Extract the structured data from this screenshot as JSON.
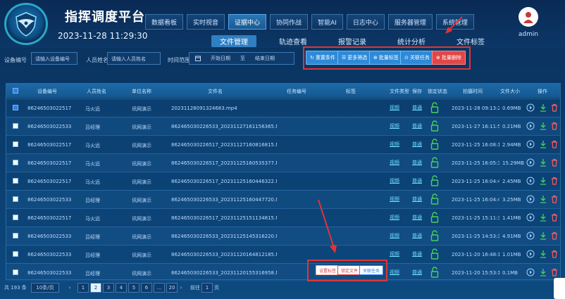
{
  "header": {
    "title": "指挥调度平台",
    "datetime": "2023-11-28 11:29:30",
    "username": "admin",
    "nav_tabs": [
      {
        "label": "数据看板",
        "active": false
      },
      {
        "label": "实时视音",
        "active": false
      },
      {
        "label": "证据中心",
        "active": true
      },
      {
        "label": "协同作战",
        "active": false
      },
      {
        "label": "智能AI",
        "active": false
      },
      {
        "label": "日志中心",
        "active": false
      },
      {
        "label": "服务器管理",
        "active": false
      },
      {
        "label": "系统管理",
        "active": false
      }
    ],
    "sub_tabs": [
      {
        "label": "文件管理",
        "active": true
      },
      {
        "label": "轨迹查看",
        "active": false
      },
      {
        "label": "报警记录",
        "active": false
      },
      {
        "label": "统计分析",
        "active": false
      },
      {
        "label": "文件标签",
        "active": false
      }
    ]
  },
  "filters": {
    "device_label": "设备编号",
    "device_placeholder": "请输入设备编号",
    "person_label": "人员姓名",
    "person_placeholder": "请输入人员姓名",
    "time_label": "时间范围",
    "start_placeholder": "开始日期",
    "range_sep": "至",
    "end_placeholder": "结束日期"
  },
  "actions": [
    {
      "label": "重置条件",
      "style": "blue"
    },
    {
      "label": "更多筛选",
      "style": "blue"
    },
    {
      "label": "批量标签",
      "style": "blue"
    },
    {
      "label": "关联任务",
      "style": "blue"
    },
    {
      "label": "批量删除",
      "style": "red"
    }
  ],
  "table": {
    "columns": [
      "设备编号",
      "人员姓名",
      "单位名称",
      "文件名",
      "任务编号",
      "标签",
      "文件类型",
      "保存",
      "锁定状态",
      "拍摄时间",
      "文件大小",
      "操作"
    ],
    "rows": [
      {
        "checked": true,
        "device": "86246503022517",
        "person": "马火远",
        "unit": "讯网演示",
        "file": "20231128091324683.mp4",
        "task": "",
        "tag": "",
        "type": "视频",
        "save": "普通",
        "time": "2023-11-28 09:13:28",
        "size": "0.69MB"
      },
      {
        "checked": false,
        "device": "86246503022533",
        "person": "吕经理",
        "unit": "讯网演示",
        "file": "862465030226533_20231127161156365.MP4",
        "task": "",
        "tag": "",
        "type": "视频",
        "save": "普通",
        "time": "2023-11-27 16:11:56",
        "size": "0.21MB"
      },
      {
        "checked": false,
        "device": "86246503022517",
        "person": "马火远",
        "unit": "讯网演示",
        "file": "862465030226517_20231127160816815.MP4",
        "task": "",
        "tag": "",
        "type": "视频",
        "save": "普通",
        "time": "2023-11-25 16:08:18",
        "size": "2.94MB"
      },
      {
        "checked": false,
        "device": "86246503022517",
        "person": "马火远",
        "unit": "讯网演示",
        "file": "862465030226517_20231125160535377.MP4",
        "task": "",
        "tag": "",
        "type": "视频",
        "save": "普通",
        "time": "2023-11-25 16:05:36",
        "size": "15.29MB"
      },
      {
        "checked": false,
        "device": "86246503022517",
        "person": "马火远",
        "unit": "讯网演示",
        "file": "862465030226517_20231125160446322.MP4",
        "task": "",
        "tag": "",
        "type": "视频",
        "save": "普通",
        "time": "2023-11-25 16:04:48",
        "size": "2.45MB"
      },
      {
        "checked": false,
        "device": "86246503022533",
        "person": "吕经理",
        "unit": "讯网演示",
        "file": "862465030226533_20231125160447720.MP4",
        "task": "",
        "tag": "",
        "type": "视频",
        "save": "普通",
        "time": "2023-11-25 16:04:47",
        "size": "3.25MB"
      },
      {
        "checked": false,
        "device": "86246503022517",
        "person": "马火远",
        "unit": "讯网演示",
        "file": "862465030226517_20231125151134815.MP4",
        "task": "",
        "tag": "",
        "type": "视频",
        "save": "普通",
        "time": "2023-11-25 15:11:36",
        "size": "1.41MB"
      },
      {
        "checked": false,
        "device": "86246503022533",
        "person": "吕经理",
        "unit": "讯网演示",
        "file": "862465030226533_20231125145316220.MP4",
        "task": "",
        "tag": "",
        "type": "视频",
        "save": "普通",
        "time": "2023-11-25 14:53:31",
        "size": "4.91MB"
      },
      {
        "checked": false,
        "device": "86246503022533",
        "person": "吕经理",
        "unit": "讯网演示",
        "file": "862465030226533_20231120164812185.MP4",
        "task": "",
        "tag": "",
        "type": "视频",
        "save": "普通",
        "time": "2023-11-20 16:48:12",
        "size": "1.01MB"
      },
      {
        "checked": false,
        "device": "86246503022533",
        "person": "吕经理",
        "unit": "讯网演示",
        "file": "862465030226533_20231120155316958.MP4",
        "task": "",
        "tag": "",
        "type": "视频",
        "save": "普通",
        "time": "2023-11-20 15:53:16",
        "size": "0.1MB"
      }
    ],
    "row_actions": [
      {
        "label": "设置标签",
        "style": "white"
      },
      {
        "label": "锁定文件",
        "style": "red"
      },
      {
        "label": "关联任务",
        "style": "blue"
      }
    ]
  },
  "pagination": {
    "total": "共 193 条",
    "page_size": "10条/页",
    "pages": [
      "1",
      "2",
      "3",
      "4",
      "5",
      "6",
      "...",
      "20"
    ],
    "active_page": "2",
    "goto_label": "前往",
    "goto_value": "1",
    "goto_suffix": "页"
  },
  "colors": {
    "accent": "#2f7fc2",
    "danger": "#e24747",
    "lock": "#49d15b"
  }
}
